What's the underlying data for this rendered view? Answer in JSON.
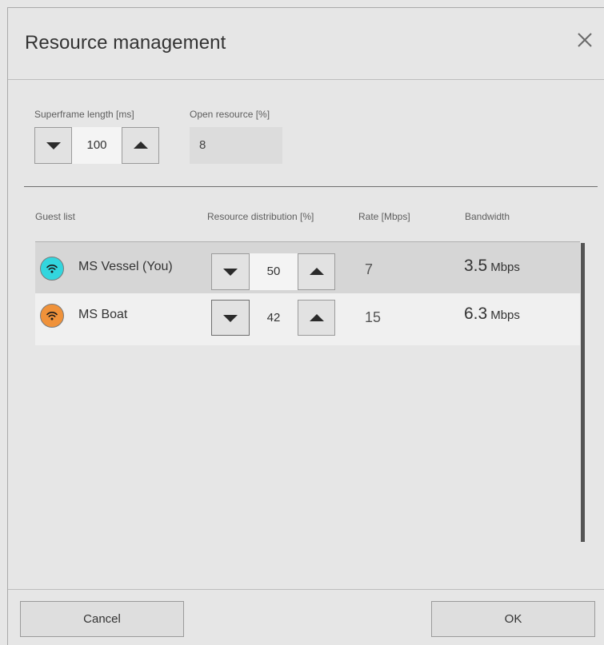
{
  "dialog": {
    "title": "Resource management",
    "close_icon": "close-icon"
  },
  "settings": {
    "superframe_label": "Superframe length [ms]",
    "superframe_value": "100",
    "open_resource_label": "Open resource [%]",
    "open_resource_value": "8"
  },
  "table": {
    "headers": {
      "guest": "Guest list",
      "distribution": "Resource distribution [%]",
      "rate": "Rate [Mbps]",
      "bandwidth": "Bandwidth"
    },
    "rows": [
      {
        "name": "MS Vessel (You)",
        "icon": "wifi-icon",
        "icon_color": "#33d6de",
        "distribution": "50",
        "rate": "7",
        "bandwidth_value": "3.5",
        "bandwidth_unit": "Mbps"
      },
      {
        "name": "MS Boat",
        "icon": "wifi-icon",
        "icon_color": "#f0923a",
        "distribution": "42",
        "rate": "15",
        "bandwidth_value": "6.3",
        "bandwidth_unit": "Mbps"
      }
    ]
  },
  "footer": {
    "cancel_label": "Cancel",
    "ok_label": "OK"
  }
}
